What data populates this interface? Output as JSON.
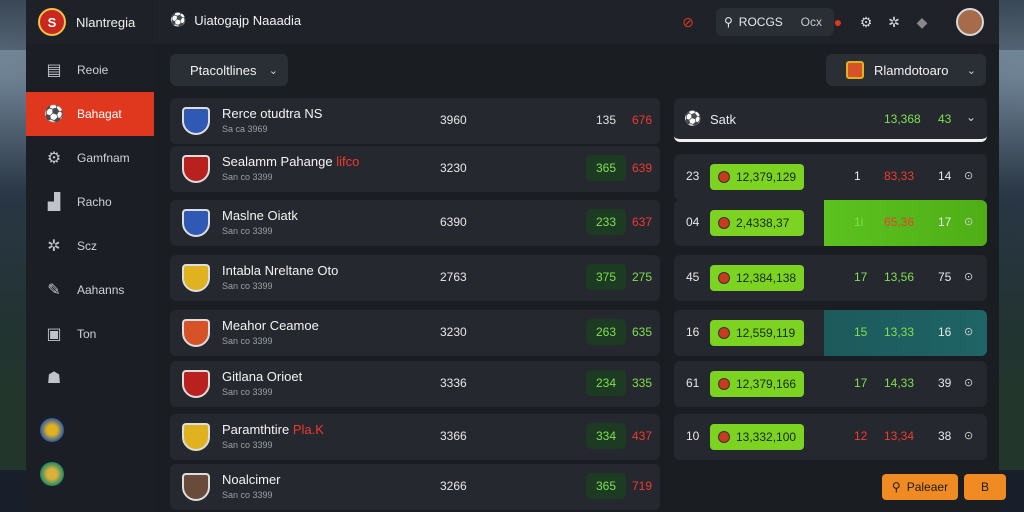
{
  "app": {
    "name": "Nlantregia",
    "title": "Uiatogajp Naaadia"
  },
  "colors": {
    "accent": "#e0381f",
    "odd_green": "#7dd321",
    "odd_red": "#ef3b32",
    "action": "#f08a22"
  },
  "sidebar": {
    "items": [
      {
        "label": "Reoie",
        "icon": "home-icon"
      },
      {
        "label": "Bahagat",
        "icon": "ball-icon",
        "active": true
      },
      {
        "label": "Gamfnam",
        "icon": "gear-icon"
      },
      {
        "label": "Racho",
        "icon": "chart-icon"
      },
      {
        "label": "Scz",
        "icon": "cog-icon"
      },
      {
        "label": "Aahanns",
        "icon": "edit-icon"
      },
      {
        "label": "Ton",
        "icon": "trash-icon"
      }
    ]
  },
  "topbar": {
    "search_text": "ROCGS",
    "search_key": "Ocx"
  },
  "filters": {
    "left": "Ptacoltlines",
    "right": "Rlamdotoaro"
  },
  "matches": [
    {
      "team": "Rerce otudtra NS",
      "team_hl": "",
      "meta": "Sa ca 3969",
      "score": "3960",
      "o1": "135",
      "o2": "676",
      "o1g": false,
      "crest": "#2f59b5"
    },
    {
      "team": "Sealamm Pahange",
      "team_hl": "lifco",
      "meta": "San co 3399",
      "score": "3230",
      "o1": "365",
      "o2": "639",
      "o1g": true,
      "crest": "#b8211e"
    },
    {
      "team": "Maslne Oiatk",
      "team_hl": "",
      "meta": "San co 3399",
      "score": "6390",
      "o1": "233",
      "o2": "637",
      "o1g": true,
      "crest": "#2f59b5"
    },
    {
      "team": "Intabla Nreltane Oto",
      "team_hl": "",
      "meta": "San co 3399",
      "score": "2763",
      "o1": "375",
      "o2": "275",
      "o1g": true,
      "crest": "#e0b21f"
    },
    {
      "team": "Meahor Ceamoe",
      "team_hl": "",
      "meta": "San co 3399",
      "score": "3230",
      "o1": "263",
      "o2": "635",
      "o1g": true,
      "crest": "#d6532a"
    },
    {
      "team": "Gitlana Orioet",
      "team_hl": "",
      "meta": "San co 3399",
      "score": "3336",
      "o1": "234",
      "o2": "335",
      "o1g": true,
      "crest": "#b8211e"
    },
    {
      "team": "Paramthtire",
      "team_hl": "Pla.K",
      "meta": "San co 3399",
      "score": "3366",
      "o1": "334",
      "o2": "437",
      "o1g": true,
      "crest": "#e0b21f"
    },
    {
      "team": "Noalcimer",
      "team_hl": "",
      "meta": "San co 3399",
      "score": "3266",
      "o1": "365",
      "o2": "719",
      "o1g": true,
      "crest": "#6a4a3a"
    }
  ],
  "panel": {
    "title": "Satk",
    "head_val1": "13,368",
    "head_val2": "43",
    "rows": [
      {
        "n": "23",
        "pill": "12,379,129",
        "c1": "1",
        "c2": "83,33",
        "c3": "14",
        "style": ""
      },
      {
        "n": "04",
        "pill": "2,4338,37",
        "c1": "1i",
        "c2": "65,36",
        "c3": "17",
        "style": "hl-green"
      },
      {
        "n": "45",
        "pill": "12,384,138",
        "c1": "17",
        "c2": "13,56",
        "c3": "75",
        "style": ""
      },
      {
        "n": "16",
        "pill": "12,559,119",
        "c1": "15",
        "c2": "13,33",
        "c3": "16",
        "style": "hl-teal"
      },
      {
        "n": "61",
        "pill": "12,379,166",
        "c1": "17",
        "c2": "14,33",
        "c3": "39",
        "style": ""
      },
      {
        "n": "10",
        "pill": "13,332,100",
        "c1": "12",
        "c2": "13,34",
        "c3": "38",
        "style": ""
      }
    ],
    "btn_primary": "Paleaer",
    "btn_secondary": "B"
  }
}
